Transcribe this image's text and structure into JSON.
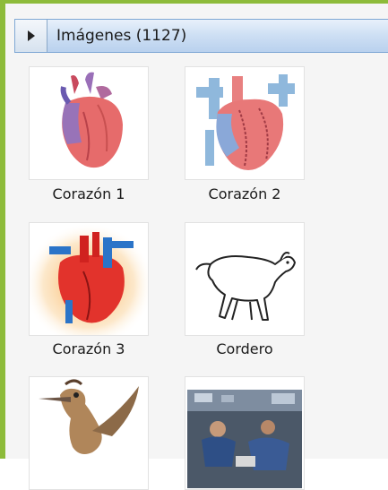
{
  "panel": {
    "title": "Imágenes (1127)",
    "toggle_icon": "triangle-right-icon"
  },
  "images": [
    {
      "label": "Corazón 1",
      "icon": "heart-anatomy-icon"
    },
    {
      "label": "Corazón 2",
      "icon": "heart-anatomy-icon"
    },
    {
      "label": "Corazón 3",
      "icon": "heart-anatomy-icon"
    },
    {
      "label": "Cordero",
      "icon": "lamb-icon"
    },
    {
      "label": "",
      "icon": "roadrunner-icon"
    },
    {
      "label": "",
      "icon": "astronauts-photo-icon"
    }
  ],
  "colors": {
    "frame_border": "#8dbb3a",
    "header_border": "#7fa8d4"
  }
}
